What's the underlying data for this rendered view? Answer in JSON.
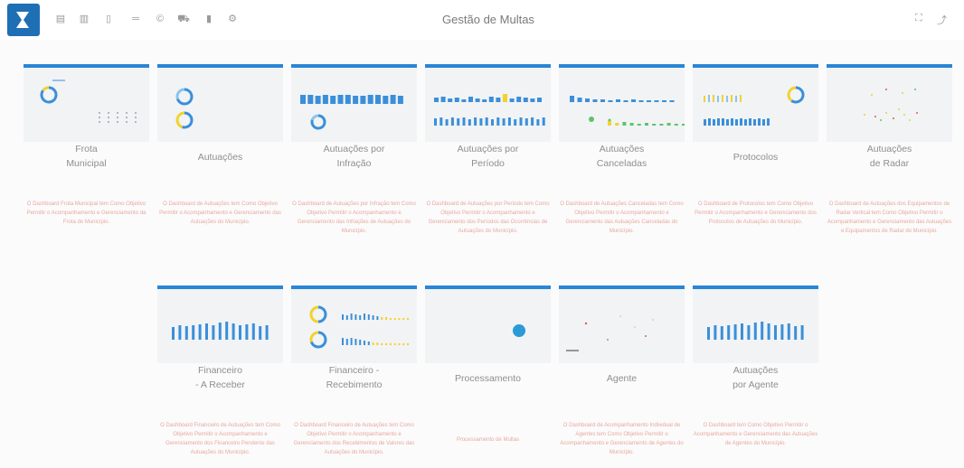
{
  "app": {
    "title": "Gestão de Multas",
    "accent": "#2a86d6",
    "toolbar_icons": [
      "calendar-icon",
      "bar-chart-icon",
      "bookmark-icon",
      "ruler-icon",
      "copyright-icon",
      "car-icon",
      "battery-icon",
      "gear-icon"
    ],
    "right_icons": [
      "fullscreen-icon",
      "export-icon"
    ]
  },
  "cards": [
    {
      "id": "frota",
      "title_lines": [
        "Frota",
        "Municipal"
      ],
      "description": "O Dashboard Frota Municipal tem Como Objetivo Permitir o Acompanhamento e Gerenciamento da Frota do Município.",
      "preview": "frota"
    },
    {
      "id": "autuacoes",
      "title_lines": [
        "Autuações"
      ],
      "description": "O Dashboard de Autuações tem Como Objetivo Permitir o Acompanhamento e Gerenciamento das Autuações do Município.",
      "preview": "autuacoes"
    },
    {
      "id": "autuacoes-infracao",
      "title_lines": [
        "Autuações por",
        "Infração"
      ],
      "description": "O Dashboard de Autuações por Infração tem Como Objetivo Permitir o Acompanhamento e Gerenciamento das Infrações de Autuações do Município.",
      "preview": "bars-donut"
    },
    {
      "id": "autuacoes-periodo",
      "title_lines": [
        "Autuações por",
        "Período"
      ],
      "description": "O Dashboard de Autuações por Período tem Como Objetivo Permitir o Acompanhamento e Gerenciamento dos Períodos das Ocorrências de Autuações do Município.",
      "preview": "bars-two"
    },
    {
      "id": "autuacoes-canceladas",
      "title_lines": [
        "Autuações",
        "Canceladas"
      ],
      "description": "O Dashboard de Autuações Canceladas tem Como Objetivo Permitir o Acompanhamento e Gerenciamento das Autuações Canceladas do Município.",
      "preview": "canceladas"
    },
    {
      "id": "protocolos",
      "title_lines": [
        "Protocolos"
      ],
      "description": "O Dashboard de Protocolos tem Como Objetivo Permitir o Acompanhamento e Gerenciamento dos Protocolos de Autuações do Município.",
      "preview": "protocolos"
    },
    {
      "id": "autuacoes-radar",
      "title_lines": [
        "Autuações",
        "de Radar"
      ],
      "description": "O Dashboard de Autuações dos Equipamentos de Radar Vertical tem Como Objetivo Permitir o Acompanhamento e Gerenciamento das Autuações e Equipamentos de Radar do Município.",
      "preview": "radar"
    },
    {
      "id": "financeiro-receber",
      "title_lines": [
        "Financeiro",
        "- A Receber"
      ],
      "description": "O Dashboard Financeiro de Autuações tem Como Objetivo Permitir o Acompanhamento e Gerenciamento dos Financeiro Pendente das Autuações do Município.",
      "preview": "bars-one"
    },
    {
      "id": "financeiro-recebimento",
      "title_lines": [
        "Financeiro -",
        "Recebimento"
      ],
      "description": "O Dashboard Financeiro de Autuações tem Como Objetivo Permitir o Acompanhamento e Gerenciamento dos Recebimentos de Valores das Autuações do Município.",
      "preview": "financeiro-rec"
    },
    {
      "id": "processamento",
      "title_lines": [
        "Processamento"
      ],
      "description": "Processamento de Multas",
      "preview": "processamento"
    },
    {
      "id": "agente",
      "title_lines": [
        "Agente"
      ],
      "description": "O Dashboard de Acompanhamento Individual de Agentes tem Como Objetivo Permitir o Acompanhamento e Gerenciamento de Agentes do Município.",
      "preview": "agente"
    },
    {
      "id": "autuacoes-agente",
      "title_lines": [
        "Autuações",
        "por Agente"
      ],
      "description": "O Dashboard tem Como Objetivo Permitir o Acompanhamento e Gerenciamento das Autuações de Agentes do Município.",
      "preview": "bars-one"
    }
  ]
}
